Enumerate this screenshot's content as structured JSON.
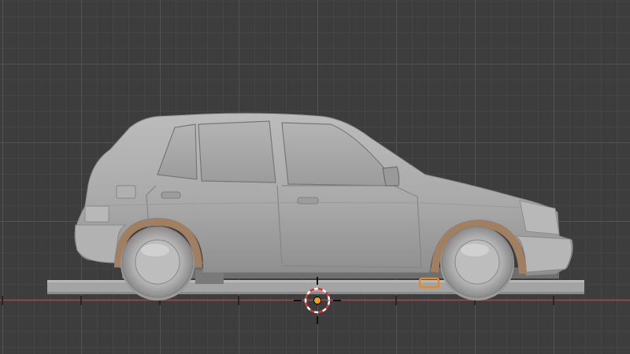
{
  "viewport": {
    "background_color": "#3d3d3d",
    "grid_minor_color": "#454545",
    "grid_major_color": "#525252",
    "x_axis_color": "#c93a3a",
    "selection_color": "#e8891b",
    "model_color": "#a8a8a8",
    "rust_color": "#a07f62",
    "cursor_icon": "3d-cursor-icon",
    "origin_icon": "object-origin-icon"
  }
}
